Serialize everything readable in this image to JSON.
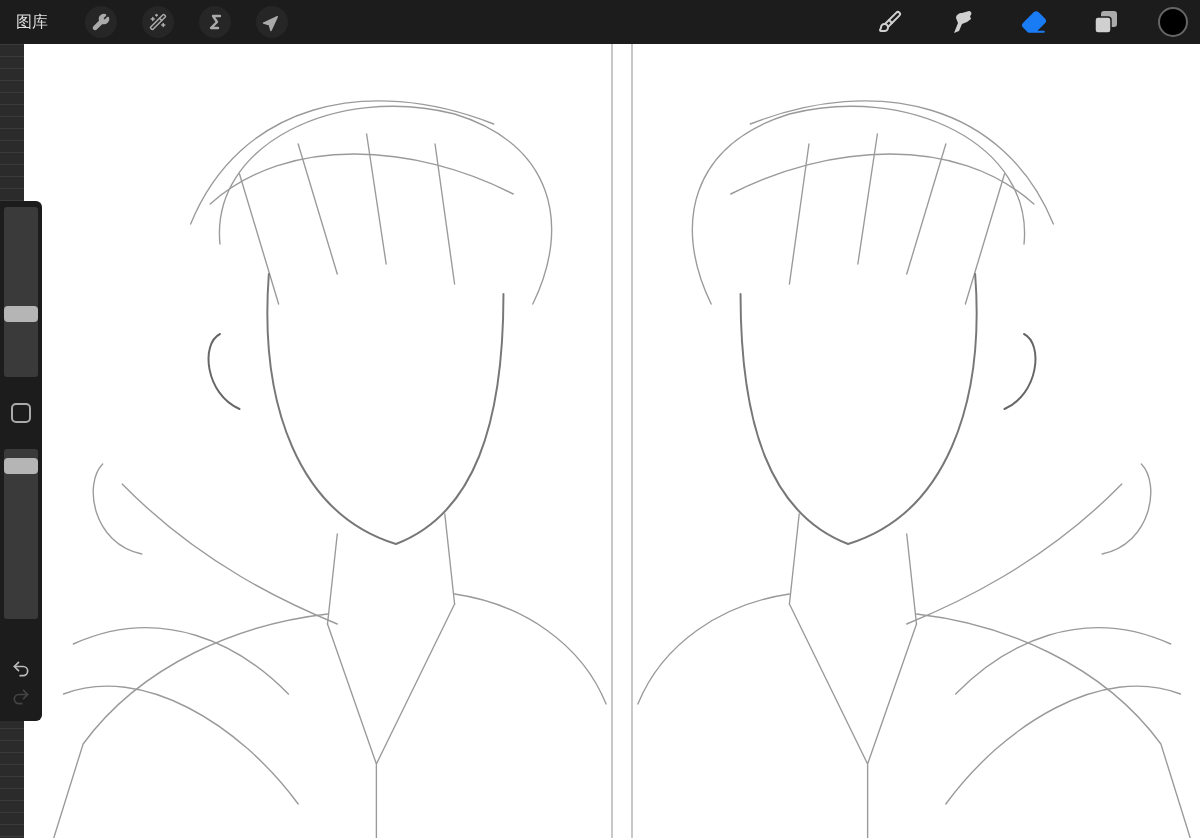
{
  "toolbar": {
    "gallery": "图库",
    "actions": [
      {
        "kind": "adjust"
      },
      {
        "kind": "magic"
      },
      {
        "kind": "select"
      },
      {
        "kind": "transform"
      }
    ],
    "tools": [
      {
        "kind": "brush",
        "selected": false
      },
      {
        "kind": "smudge",
        "selected": false
      },
      {
        "kind": "eraser",
        "selected": true
      },
      {
        "kind": "layers",
        "selected": false
      }
    ],
    "color": "#000000"
  },
  "sidebar": {
    "brush_size": {
      "level": 0.36
    },
    "opacity": {
      "level": 0.94
    },
    "undo": {
      "disabled": false
    },
    "redo": {
      "disabled": true
    }
  }
}
